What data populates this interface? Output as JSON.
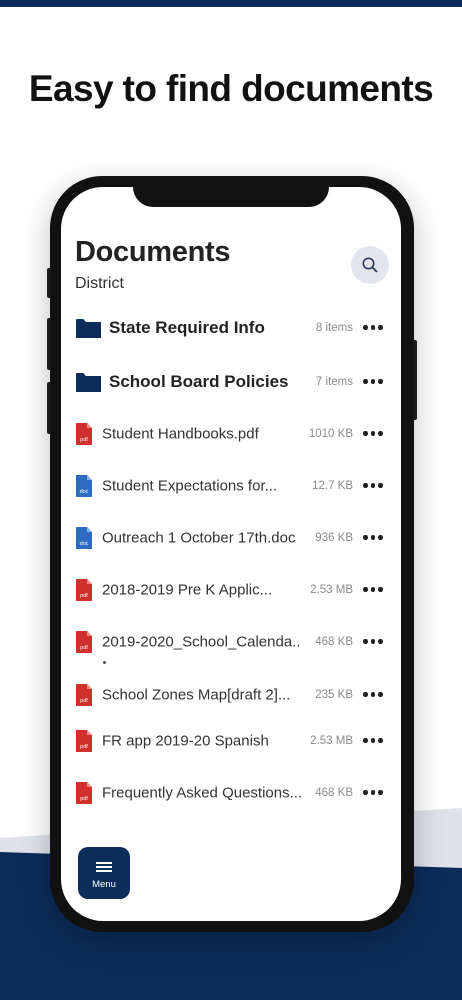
{
  "promo": {
    "headline": "Easy to find documents",
    "colors": {
      "navy": "#0c2c5a",
      "pdf_red": "#d0312d",
      "doc_blue": "#2d6cc0",
      "light_wave": "#dfe2ea"
    }
  },
  "app": {
    "title": "Documents",
    "subtitle": "District",
    "search_icon": "search-icon",
    "folders": [
      {
        "name": "State Required Info",
        "meta": "8 items",
        "icon": "folder-icon"
      },
      {
        "name": "School Board Policies",
        "meta": "7 items",
        "icon": "folder-icon"
      }
    ],
    "files": [
      {
        "name": "Student Handbooks.pdf",
        "size": "1010 KB",
        "type": "pdf"
      },
      {
        "name": "Student Expectations for...",
        "size": "12.7 KB",
        "type": "doc"
      },
      {
        "name": "Outreach 1 October 17th.doc",
        "size": "936 KB",
        "type": "doc"
      },
      {
        "name": "2018-2019 Pre K Applic...",
        "size": "2.53 MB",
        "type": "pdf"
      },
      {
        "name": "2019-2020_School_Calenda..",
        "size": "468 KB",
        "type": "pdf"
      },
      {
        "name": "School Zones Map[draft 2]...",
        "size": "235 KB",
        "type": "pdf"
      },
      {
        "name": "FR app 2019-20 Spanish",
        "size": "2.53 MB",
        "type": "pdf"
      },
      {
        "name": "Frequently Asked Questions...",
        "size": "468 KB",
        "type": "pdf"
      }
    ],
    "menu": {
      "label": "Menu",
      "icon": "hamburger-icon"
    }
  }
}
